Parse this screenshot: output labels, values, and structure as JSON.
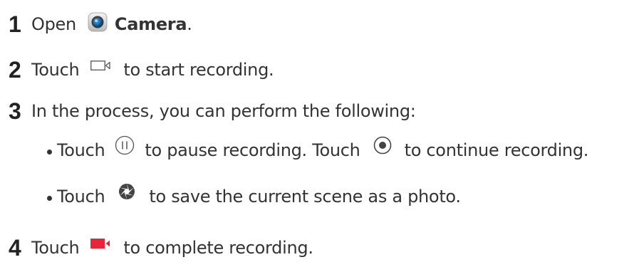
{
  "steps": [
    {
      "number": "1",
      "text_before": "Open",
      "icon": "camera-app-icon",
      "bold_text": "Camera",
      "text_after": "."
    },
    {
      "number": "2",
      "text_before": "Touch",
      "icon": "video-mode-icon",
      "text_after": "to start recording."
    },
    {
      "number": "3",
      "text": "In the process, you can perform the following:",
      "bullets": [
        {
          "text_before": "Touch",
          "icon": "pause-icon",
          "text_middle": "to pause recording. Touch",
          "icon2": "resume-record-icon",
          "text_after": "to continue recording."
        },
        {
          "text_before": "Touch",
          "icon": "shutter-icon",
          "text_after": "to save the current scene as a photo."
        }
      ]
    },
    {
      "number": "4",
      "text_before": "Touch",
      "icon": "stop-record-icon",
      "text_after": "to complete recording."
    }
  ],
  "colors": {
    "text": "#333333",
    "stop_icon": "#e8243a",
    "camera_icon_lens": "#1a6fb5"
  }
}
